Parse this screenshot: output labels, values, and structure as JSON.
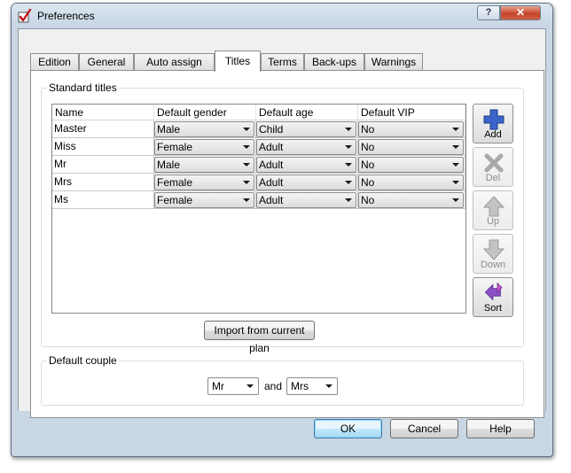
{
  "window": {
    "title": "Preferences",
    "help_label": "?",
    "close_label": "✕"
  },
  "tabs": [
    {
      "label": "Edition"
    },
    {
      "label": "General"
    },
    {
      "label": "Auto assign"
    },
    {
      "label": "Titles",
      "active": true
    },
    {
      "label": "Terms"
    },
    {
      "label": "Back-ups"
    },
    {
      "label": "Warnings"
    }
  ],
  "standard_titles": {
    "group_label": "Standard titles",
    "columns": [
      "Name",
      "Default gender",
      "Default age",
      "Default VIP"
    ],
    "rows": [
      {
        "name": "Master",
        "gender": "Male",
        "age": "Child",
        "vip": "No"
      },
      {
        "name": "Miss",
        "gender": "Female",
        "age": "Adult",
        "vip": "No"
      },
      {
        "name": "Mr",
        "gender": "Male",
        "age": "Adult",
        "vip": "No"
      },
      {
        "name": "Mrs",
        "gender": "Female",
        "age": "Adult",
        "vip": "No"
      },
      {
        "name": "Ms",
        "gender": "Female",
        "age": "Adult",
        "vip": "No"
      }
    ],
    "import_label": "Import from current plan",
    "side_buttons": {
      "add": "Add",
      "del": "Del",
      "up": "Up",
      "down": "Down",
      "sort": "Sort"
    }
  },
  "default_couple": {
    "group_label": "Default couple",
    "first": "Mr",
    "and_label": "and",
    "second": "Mrs"
  },
  "footer": {
    "ok_label": "OK",
    "cancel_label": "Cancel",
    "help_label": "Help"
  },
  "colors": {
    "titlebar": "#c6d5e4",
    "close": "#c5452b",
    "add_icon": "#3a64c8",
    "sort_icon": "#8a4fc4"
  }
}
